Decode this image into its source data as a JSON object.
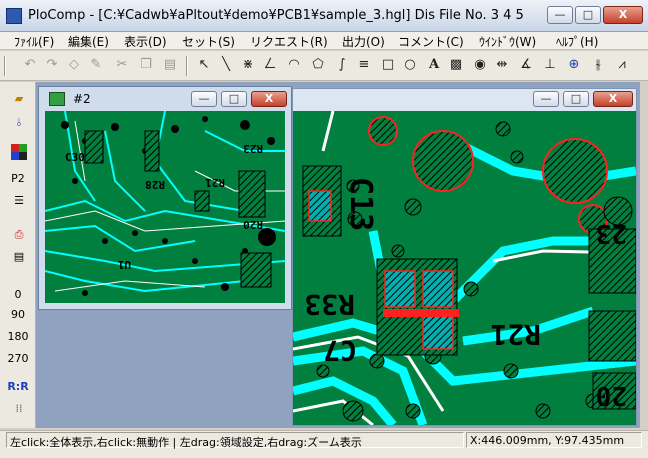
{
  "window": {
    "title": "PloComp - [C:¥Cadwb¥aPltout¥demo¥PCB1¥sample_3.hgl] Dis File No. 3 4 5",
    "minimize": "—",
    "maximize": "□",
    "close": "X"
  },
  "menu": [
    "ﾌｧｲﾙ(F)",
    "編集(E)",
    "表示(D)",
    "セット(S)",
    "リクエスト(R)",
    "出力(O)",
    "コメント(C)",
    "ｳｲﾝﾄﾞｳ(W)",
    "ﾍﾙﾌﾟ(H)"
  ],
  "toolbar_icons": [
    "undo-icon",
    "redo-icon",
    "eraser-icon",
    "pen-icon",
    "cut-icon",
    "copy-icon",
    "paste-icon",
    "pointer-icon",
    "line-icon",
    "cross-line-icon",
    "zigzag-icon",
    "arc-icon",
    "polygon-icon",
    "curve-icon",
    "multiline-icon",
    "rectangle-icon",
    "ellipse-icon",
    "text-icon",
    "hatch-icon",
    "circle-target-icon",
    "measure-icon",
    "angle-icon",
    "dimension-icon",
    "parallel-icon",
    "slope-icon"
  ],
  "left_toolbar": {
    "layer_label": "P2",
    "rotation": [
      "0",
      "90",
      "180",
      "270"
    ],
    "mirror_label": "R:R"
  },
  "board_window": {
    "labels": [
      "C13",
      "R33",
      "C7",
      "R21",
      "23",
      "20"
    ]
  },
  "sub_window": {
    "title": "#2",
    "labels": [
      "R21",
      "R23",
      "R20",
      "R28",
      "U1",
      "C30"
    ]
  },
  "status": {
    "help": "左click:全体表示,右click:無動作 | 左drag:領域設定,右drag:ズーム表示",
    "coords": "X:446.009mm, Y:97.435mm"
  },
  "colors": {
    "board_green": "#007f3f",
    "trace_cyan": "#00ffff",
    "highlight_red": "#ff2020",
    "hatch_black": "#000000"
  }
}
